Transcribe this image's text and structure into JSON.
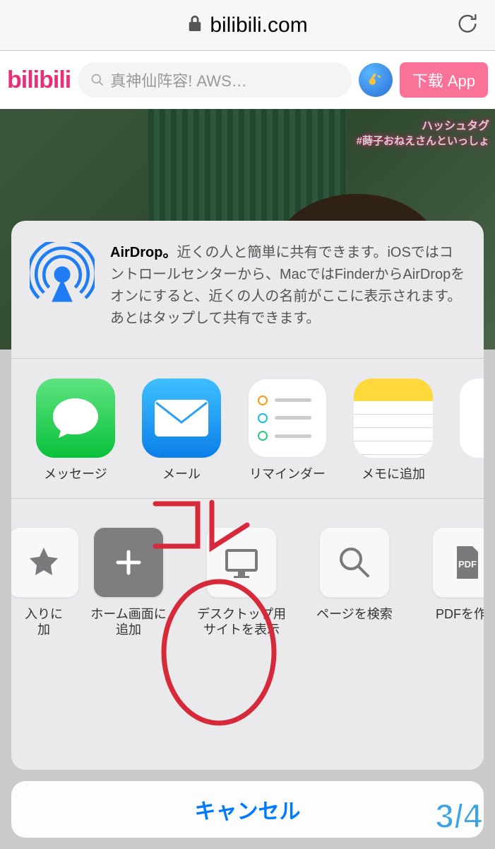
{
  "browser": {
    "url": "bilibili.com"
  },
  "header": {
    "logo": "bilibili",
    "search_placeholder": "真神仙阵容! AWS…",
    "download_label": "下载 App"
  },
  "video": {
    "hashtag_label": "ハッシュタグ",
    "hashtag_text": "#蒔子おねえさんといっしょ"
  },
  "share_sheet": {
    "airdrop": {
      "title": "AirDrop。",
      "body": "近くの人と簡単に共有できます。iOSではコントロールセンターから、MacではFinderからAirDropをオンにすると、近くの人の名前がここに表示されます。あとはタップして共有できます。"
    },
    "apps": [
      {
        "label": "メッセージ",
        "icon": "messages"
      },
      {
        "label": "メール",
        "icon": "mail"
      },
      {
        "label": "リマインダー",
        "icon": "reminders"
      },
      {
        "label": "メモに追加",
        "icon": "notes"
      }
    ],
    "actions": [
      {
        "label": "入りに\n加",
        "icon": "star"
      },
      {
        "label": "ホーム画面に\n追加",
        "icon": "plus"
      },
      {
        "label": "デスクトップ用\nサイトを表示",
        "icon": "desktop"
      },
      {
        "label": "ページを検索",
        "icon": "search"
      },
      {
        "label": "PDFを作成",
        "icon": "pdf"
      }
    ],
    "cancel_label": "キャンセル"
  },
  "annotation": {
    "text": "コレ"
  },
  "overlay": {
    "page_counter": "3/4"
  }
}
